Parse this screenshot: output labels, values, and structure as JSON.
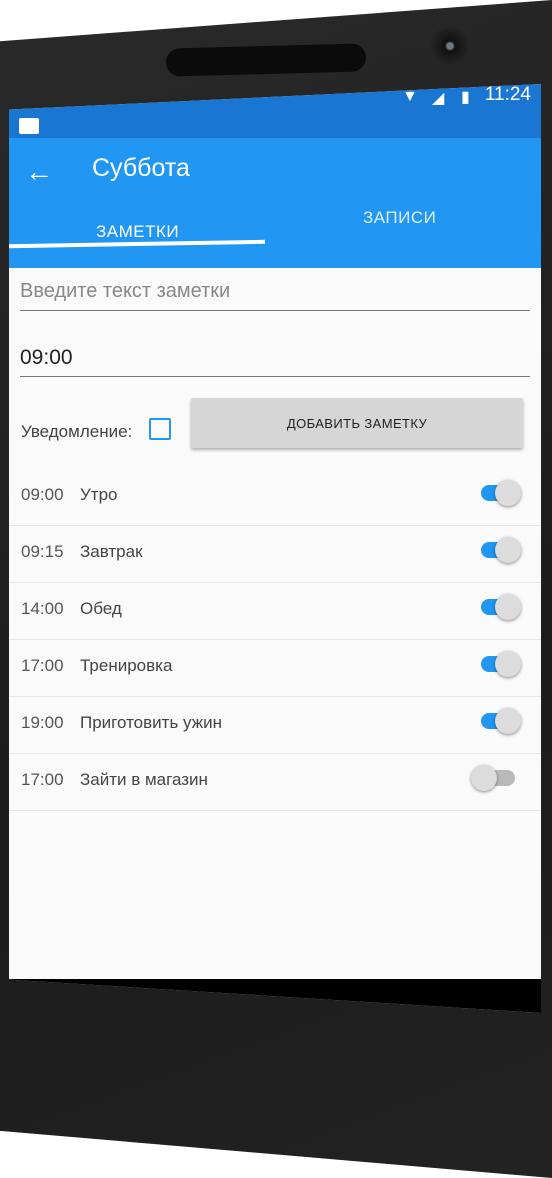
{
  "status_bar": {
    "time": "11:24",
    "icons": [
      "notification-folder-icon",
      "wifi-icon",
      "no-signal-icon",
      "battery-charging-icon"
    ]
  },
  "app_bar": {
    "title": "Суббота",
    "back_icon": "arrow-left-icon"
  },
  "tabs": [
    {
      "label": "ЗАМЕТКИ",
      "selected": true
    },
    {
      "label": "ЗАПИСИ",
      "selected": false
    }
  ],
  "form": {
    "note_placeholder": "Введите текст заметки",
    "time_value": "09:00",
    "notification_label": "Уведомление:",
    "notification_checked": false,
    "add_button_label": "ДОБАВИТЬ ЗАМЕТКУ"
  },
  "notes": [
    {
      "time": "09:00",
      "text": "Утро",
      "enabled": true
    },
    {
      "time": "09:15",
      "text": "Завтрак",
      "enabled": true
    },
    {
      "time": "14:00",
      "text": "Обед",
      "enabled": true
    },
    {
      "time": "17:00",
      "text": "Тренировка",
      "enabled": true
    },
    {
      "time": "19:00",
      "text": "Приготовить ужин",
      "enabled": true
    },
    {
      "time": "17:00",
      "text": "Зайти в магазин",
      "enabled": false
    }
  ],
  "nav_bar": {
    "icons": [
      "back-triangle-icon",
      "home-circle-icon",
      "recents-square-icon"
    ]
  },
  "colors": {
    "primary": "#2196f3",
    "primary_dark": "#1976d2",
    "background": "#fafafa"
  }
}
